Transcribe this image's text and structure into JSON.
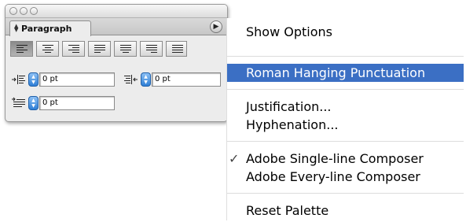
{
  "palette": {
    "tab_label": "Paragraph",
    "alignment_buttons": [
      {
        "name": "align-left",
        "selected": true
      },
      {
        "name": "align-center",
        "selected": false
      },
      {
        "name": "align-right",
        "selected": false
      },
      {
        "name": "justify-last-left",
        "selected": false
      },
      {
        "name": "justify-last-center",
        "selected": false
      },
      {
        "name": "justify-last-right",
        "selected": false
      },
      {
        "name": "justify-all",
        "selected": false
      }
    ],
    "left_indent": "0 pt",
    "right_indent": "0 pt",
    "first_line_indent": "0 pt"
  },
  "menu": {
    "show_options": "Show Options",
    "roman_hanging_punctuation": "Roman Hanging Punctuation",
    "justification": "Justification...",
    "hyphenation": "Hyphenation...",
    "single_line_composer": "Adobe Single-line Composer",
    "every_line_composer": "Adobe Every-line Composer",
    "reset_palette": "Reset Palette",
    "checkmark": "✓",
    "checked_item": "single_line_composer"
  },
  "colors": {
    "highlight": "#3b6fc4",
    "stepper": "#3a87dc"
  }
}
